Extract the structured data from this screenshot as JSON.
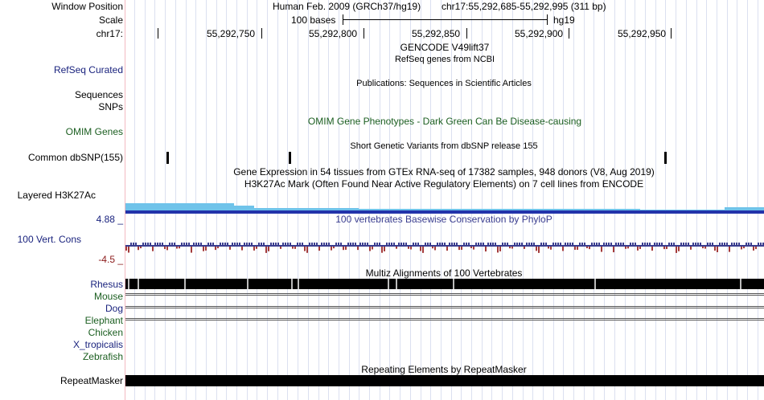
{
  "labels": {
    "window_position": "Window Position",
    "scale": "Scale",
    "chrom": "chr17:",
    "refseq": "RefSeq Curated",
    "sequences": "Sequences",
    "snps": "SNPs",
    "omim": "OMIM Genes",
    "common_dbsnp": "Common dbSNP(155)",
    "layered": "Layered H3K27Ac",
    "cons_max": "4.88 _",
    "cons_label": "100 Vert. Cons",
    "cons_min": "-4.5 _",
    "species": [
      {
        "name": "Rhesus",
        "color": "#1a237e"
      },
      {
        "name": "Mouse",
        "color": "#1b5e20"
      },
      {
        "name": "Dog",
        "color": "#1a237e"
      },
      {
        "name": "Elephant",
        "color": "#1b5e20"
      },
      {
        "name": "Chicken",
        "color": "#1b5e20"
      },
      {
        "name": "X_tropicalis",
        "color": "#1a237e"
      },
      {
        "name": "Zebrafish",
        "color": "#1b5e20"
      }
    ],
    "repeatmasker": "RepeatMasker"
  },
  "header": {
    "assembly": "Human Feb. 2009 (GRCh37/hg19)",
    "position": "chr17:55,292,685-55,292,995 (311 bp)",
    "scale_text": "100 bases",
    "scale_db": "hg19"
  },
  "ruler": {
    "positions": [
      "55,292,750",
      "55,292,800",
      "55,292,850",
      "55,292,900",
      "55,292,950"
    ]
  },
  "tracks": {
    "gencode": "GENCODE V49lift37",
    "refseq_desc": "RefSeq genes from NCBI",
    "publications": "Publications: Sequences in Scientific Articles",
    "omim_desc": "OMIM Gene Phenotypes - Dark Green Can Be Disease-causing",
    "dbsnp_desc": "Short Genetic Variants from dbSNP release 155",
    "gtex_desc": "Gene Expression in 54 tissues from GTEx RNA-seq of 17382 samples, 948 donors (V8, Aug 2019)",
    "h3k27_desc": "H3K27Ac Mark (Often Found Near Active Regulatory Elements) on 7 cell lines from ENCODE",
    "phylop_desc": "100 vertebrates Basewise Conservation by PhyloP",
    "multiz_desc": "Multiz Alignments of 100 Vertebrates",
    "repeat_desc": "Repeating Elements by RepeatMasker"
  },
  "colors": {
    "label_blue": "#1a237e",
    "label_green": "#1b5e20",
    "cons_blue": "#3a3d8f",
    "cons_red": "#a33a3a",
    "h3k27_light": "#6fc3ea",
    "h3k27_dark": "#2233aa"
  }
}
